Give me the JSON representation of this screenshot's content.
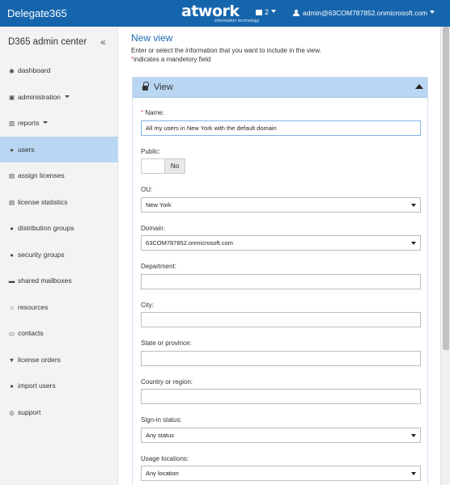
{
  "header": {
    "brand": "Delegate365",
    "logo_main": "atwork",
    "logo_sub": "information technology",
    "notif_count": "2",
    "user_email": "admin@63COM787852.onmicrosoft.com"
  },
  "sidebar": {
    "title": "D365 admin center",
    "collapse_glyph": "«",
    "items": [
      {
        "label": "dashboard",
        "icon": "dashboard-icon",
        "glyph": "◉"
      },
      {
        "label": "administration",
        "icon": "lock-icon",
        "glyph": "▣"
      },
      {
        "label": "reports",
        "icon": "bar-chart-icon",
        "glyph": "▥"
      },
      {
        "label": "users",
        "icon": "user-icon",
        "glyph": "●"
      },
      {
        "label": "assign licenses",
        "icon": "file-icon",
        "glyph": "▤"
      },
      {
        "label": "license statistics",
        "icon": "file-text-icon",
        "glyph": "▤"
      },
      {
        "label": "distribution groups",
        "icon": "users-icon",
        "glyph": "●"
      },
      {
        "label": "security groups",
        "icon": "users-icon",
        "glyph": "●"
      },
      {
        "label": "shared mailboxes",
        "icon": "inbox-icon",
        "glyph": "▬"
      },
      {
        "label": "resources",
        "icon": "home-icon",
        "glyph": "⌂"
      },
      {
        "label": "contacts",
        "icon": "card-icon",
        "glyph": "▭"
      },
      {
        "label": "license orders",
        "icon": "cart-icon",
        "glyph": "▼"
      },
      {
        "label": "import users",
        "icon": "user-icon",
        "glyph": "●"
      },
      {
        "label": "support",
        "icon": "support-icon",
        "glyph": "◎"
      }
    ]
  },
  "main": {
    "title": "New view",
    "intro": "Enter or select the information that you want to include in the view.",
    "required_star": "*",
    "required_note": "indicates a mandetory field",
    "panel": {
      "title": "View"
    },
    "form": {
      "name_label": "Name:",
      "name_value": "All my users in New York with the default domain",
      "public_label": "Public:",
      "public_value": "No",
      "ou_label": "OU:",
      "ou_value": "New York",
      "domain_label": "Domain:",
      "domain_value": "63COM787852.onmicrosoft.com",
      "department_label": "Department:",
      "department_value": "",
      "city_label": "City:",
      "city_value": "",
      "state_label": "State or province:",
      "state_value": "",
      "country_label": "Country or region:",
      "country_value": "",
      "signin_label": "Sign-in status:",
      "signin_value": "Any status",
      "usage_label": "Usage locations:",
      "usage_value": "Any location"
    }
  },
  "colors": {
    "topbar": "#1565ad",
    "active_nav": "#b9d7f3",
    "title_blue": "#1e6bb8",
    "required_red": "#d9534f"
  }
}
